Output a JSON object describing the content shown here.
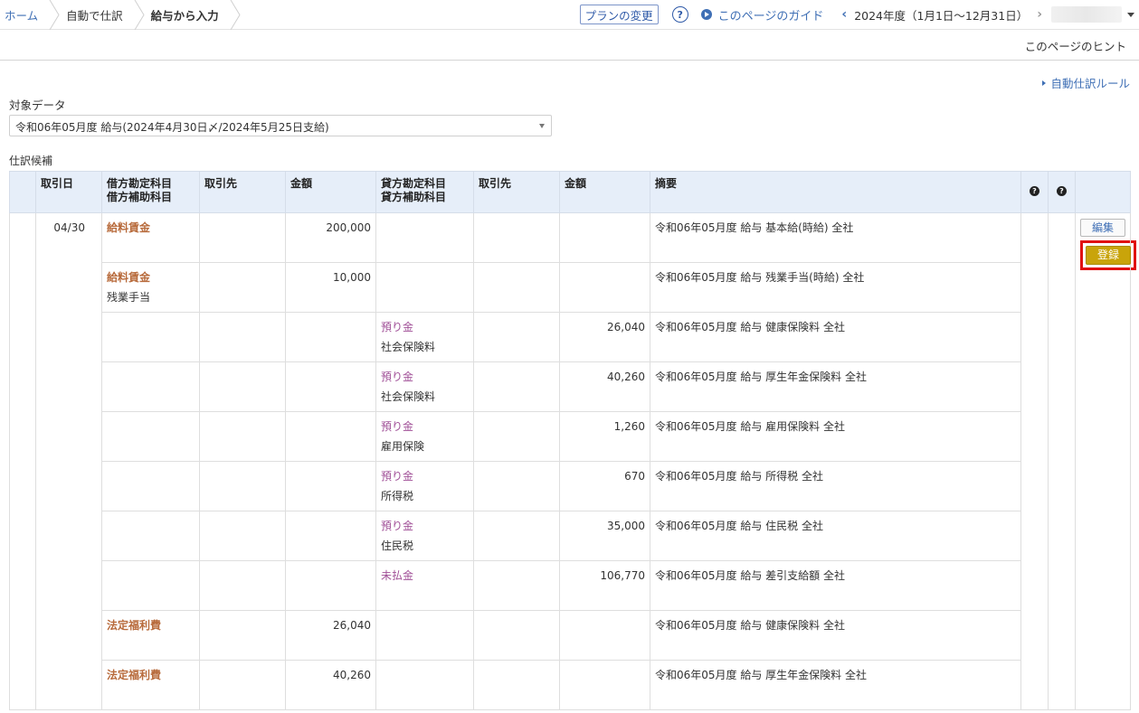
{
  "breadcrumbs": [
    "ホーム",
    "自動で仕訳",
    "給与から入力"
  ],
  "header": {
    "plan_button": "プランの変更",
    "help_symbol": "?",
    "guide_link": "このページのガイド",
    "year": "2024年度（1月1日～12月31日）"
  },
  "hint_link": "このページのヒント",
  "auto_rule_link": "自動仕訳ルール",
  "target": {
    "label": "対象データ",
    "selected": "令和06年05月度 給与(2024年4月30日〆/2024年5月25日支給)"
  },
  "candidates_label": "仕訳候補",
  "table": {
    "headers": {
      "date": "取引日",
      "debit_account": "借方勘定科目",
      "debit_sub": "借方補助科目",
      "debit_partner": "取引先",
      "debit_amount": "金額",
      "credit_account": "貸方勘定科目",
      "credit_sub": "貸方補助科目",
      "credit_partner": "取引先",
      "credit_amount": "金額",
      "memo": "摘要",
      "q1": "?",
      "q2": "?"
    },
    "date": "04/30",
    "edit_button": "編集",
    "register_button": "登録",
    "rows": [
      {
        "debit_account": "給料賃金",
        "debit_sub": "",
        "debit_amount": "200,000",
        "credit_account": "",
        "credit_sub": "",
        "credit_amount": "",
        "memo": "令和06年05月度 給与 基本給(時給) 全社"
      },
      {
        "debit_account": "給料賃金",
        "debit_sub": "残業手当",
        "debit_amount": "10,000",
        "credit_account": "",
        "credit_sub": "",
        "credit_amount": "",
        "memo": "令和06年05月度 給与 残業手当(時給) 全社"
      },
      {
        "debit_account": "",
        "debit_sub": "",
        "debit_amount": "",
        "credit_account": "預り金",
        "credit_sub": "社会保険料",
        "credit_amount": "26,040",
        "memo": "令和06年05月度 給与 健康保険料 全社"
      },
      {
        "debit_account": "",
        "debit_sub": "",
        "debit_amount": "",
        "credit_account": "預り金",
        "credit_sub": "社会保険料",
        "credit_amount": "40,260",
        "memo": "令和06年05月度 給与 厚生年金保険料 全社"
      },
      {
        "debit_account": "",
        "debit_sub": "",
        "debit_amount": "",
        "credit_account": "預り金",
        "credit_sub": "雇用保険",
        "credit_amount": "1,260",
        "memo": "令和06年05月度 給与 雇用保険料 全社"
      },
      {
        "debit_account": "",
        "debit_sub": "",
        "debit_amount": "",
        "credit_account": "預り金",
        "credit_sub": "所得税",
        "credit_amount": "670",
        "memo": "令和06年05月度 給与 所得税 全社"
      },
      {
        "debit_account": "",
        "debit_sub": "",
        "debit_amount": "",
        "credit_account": "預り金",
        "credit_sub": "住民税",
        "credit_amount": "35,000",
        "memo": "令和06年05月度 給与 住民税 全社"
      },
      {
        "debit_account": "",
        "debit_sub": "",
        "debit_amount": "",
        "credit_account": "未払金",
        "credit_sub": "",
        "credit_amount": "106,770",
        "memo": "令和06年05月度 給与 差引支給額 全社"
      },
      {
        "debit_account": "法定福利費",
        "debit_sub": "",
        "debit_amount": "26,040",
        "credit_account": "",
        "credit_sub": "",
        "credit_amount": "",
        "memo": "令和06年05月度 給与 健康保険料 全社"
      },
      {
        "debit_account": "法定福利費",
        "debit_sub": "",
        "debit_amount": "40,260",
        "credit_account": "",
        "credit_sub": "",
        "credit_amount": "",
        "memo": "令和06年05月度 給与 厚生年金保険料 全社"
      }
    ]
  }
}
